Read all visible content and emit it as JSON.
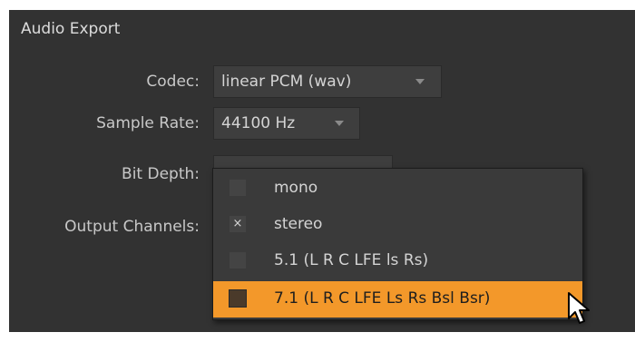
{
  "section": {
    "title": "Audio Export"
  },
  "fields": {
    "codec": {
      "label": "Codec:",
      "value": "linear PCM (wav)"
    },
    "sample_rate": {
      "label": "Sample Rate:",
      "value": "44100 Hz"
    },
    "bit_depth": {
      "label": "Bit Depth:"
    },
    "output_channels": {
      "label": "Output Channels:"
    }
  },
  "channel_options": [
    {
      "label": "mono",
      "checked": false,
      "highlighted": false
    },
    {
      "label": "stereo",
      "checked": true,
      "check_glyph": "×",
      "highlighted": false
    },
    {
      "label": "5.1 (L R C LFE ls Rs)",
      "checked": false,
      "highlighted": false
    },
    {
      "label": "7.1 (L R C LFE Ls Rs Bsl Bsr)",
      "checked": false,
      "highlighted": true
    }
  ],
  "colors": {
    "panel_bg": "#323232",
    "highlight": "#f3982a"
  },
  "icons": {
    "dropdown_arrow": "chevron-down-icon",
    "cursor": "mouse-pointer-icon"
  }
}
